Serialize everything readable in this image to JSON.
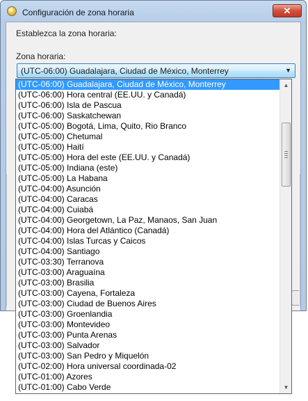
{
  "window": {
    "title": "Configuración de zona horaria",
    "close_label": "✕"
  },
  "dialog": {
    "heading": "Establezca la zona horaria:",
    "timezone_label": "Zona horaria:",
    "selected_value": "(UTC-06:00) Guadalajara, Ciudad de México, Monterrey"
  },
  "timezone_options": [
    "(UTC-06:00) Guadalajara, Ciudad de México, Monterrey",
    "(UTC-06:00) Hora central (EE.UU. y Canadá)",
    "(UTC-06:00) Isla de Pascua",
    "(UTC-06:00) Saskatchewan",
    "(UTC-05:00) Bogotá, Lima, Quito, Rio Branco",
    "(UTC-05:00) Chetumal",
    "(UTC-05:00) Haití",
    "(UTC-05:00) Hora del este (EE.UU. y Canadá)",
    "(UTC-05:00) Indiana (este)",
    "(UTC-05:00) La Habana",
    "(UTC-04:00) Asunción",
    "(UTC-04:00) Caracas",
    "(UTC-04:00) Cuiabá",
    "(UTC-04:00) Georgetown, La Paz, Manaos, San Juan",
    "(UTC-04:00) Hora del Atlántico (Canadá)",
    "(UTC-04:00) Islas Turcas y Caicos",
    "(UTC-04:00) Santiago",
    "(UTC-03:30) Terranova",
    "(UTC-03:00) Araguaína",
    "(UTC-03:00) Brasilia",
    "(UTC-03:00) Cayena, Fortaleza",
    "(UTC-03:00) Ciudad de Buenos Aires",
    "(UTC-03:00) Groenlandia",
    "(UTC-03:00) Montevideo",
    "(UTC-03:00) Punta Arenas",
    "(UTC-03:00) Salvador",
    "(UTC-03:00) San Pedro y Miquelón",
    "(UTC-02:00) Hora universal coordinada-02",
    "(UTC-01:00) Azores",
    "(UTC-01:00) Cabo Verde"
  ],
  "selected_index": 0,
  "icons": {
    "window": "globe-clock-icon",
    "dropdown_arrow": "chevron-down-icon",
    "scroll_up": "scroll-up-arrow-icon",
    "scroll_down": "scroll-down-arrow-icon"
  }
}
